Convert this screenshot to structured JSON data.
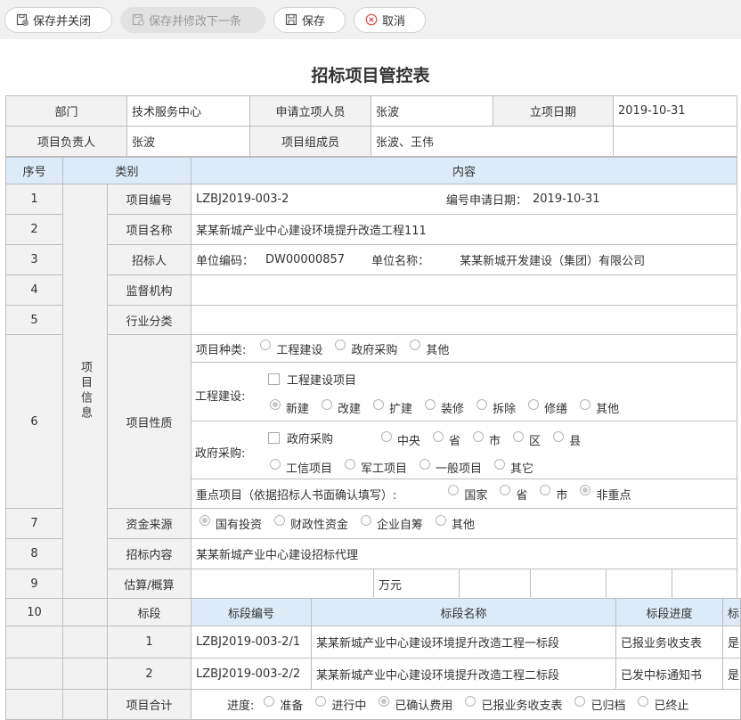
{
  "toolbar": {
    "save_close": "保存并关闭",
    "save_next": "保存并修改下一条",
    "save": "保存",
    "cancel": "取消"
  },
  "title": "招标项目管控表",
  "header": {
    "dept_label": "部门",
    "dept_value": "技术服务中心",
    "applicant_label": "申请立项人员",
    "applicant_value": "张波",
    "date_label": "立项日期",
    "date_value": "2019-10-31",
    "leader_label": "项目负责人",
    "leader_value": "张波",
    "members_label": "项目组成员",
    "members_value": "张波、王伟"
  },
  "cols": {
    "no": "序号",
    "category": "类别",
    "content": "内容"
  },
  "group_label": "项目信息",
  "rows": {
    "r1": {
      "no": "1",
      "label": "项目编号",
      "code": "LZBJ2019-003-2",
      "date_label": "编号申请日期：",
      "date_value": "2019-10-31"
    },
    "r2": {
      "no": "2",
      "label": "项目名称",
      "value": "某某新城产业中心建设环境提升改造工程111"
    },
    "r3": {
      "no": "3",
      "label": "招标人",
      "code_label": "单位编码：",
      "code_value": "DW00000857",
      "name_label": "单位名称：",
      "name_value": "某某新城开发建设（集团）有限公司"
    },
    "r4": {
      "no": "4",
      "label": "监督机构"
    },
    "r5": {
      "no": "5",
      "label": "行业分类"
    },
    "r6": {
      "no": "6",
      "label": "项目性质",
      "kind_label": "项目种类:",
      "kind_opts": [
        "工程建设",
        "政府采购",
        "其他"
      ],
      "eng_label": "工程建设:",
      "eng_check": "工程建设项目",
      "eng_opts": [
        "新建",
        "改建",
        "扩建",
        "装修",
        "拆除",
        "修缮",
        "其他"
      ],
      "gov_label": "政府采购:",
      "gov_check": "政府采购",
      "gov_level_opts": [
        "中央",
        "省",
        "市",
        "区",
        "县"
      ],
      "gov_type_opts": [
        "工信项目",
        "军工项目",
        "一般项目",
        "其它"
      ],
      "key_label": "重点项目（依据招标人书面确认填写）:",
      "key_opts": [
        "国家",
        "省",
        "市",
        "非重点"
      ]
    },
    "r7": {
      "no": "7",
      "label": "资金来源",
      "opts": [
        "国有投资",
        "财政性资金",
        "企业自筹",
        "其他"
      ]
    },
    "r8": {
      "no": "8",
      "label": "招标内容",
      "value": "某某新城产业中心建设招标代理"
    },
    "r9": {
      "no": "9",
      "label": "估算/概算",
      "unit": "万元"
    },
    "r10": {
      "no": "10",
      "label": "标段",
      "col_code": "标段编号",
      "col_name": "标段名称",
      "col_progress": "标段进度",
      "col_extra": "标"
    },
    "lots": [
      {
        "no": "1",
        "code": "LZBJ2019-003-2/1",
        "name": "某某新城产业中心建设环境提升改造工程一标段",
        "progress": "已报业务收支表",
        "extra": "是"
      },
      {
        "no": "2",
        "code": "LZBJ2019-003-2/2",
        "name": "某某新城产业中心建设环境提升改造工程二标段",
        "progress": "已发中标通知书",
        "extra": "是"
      }
    ],
    "total": {
      "label": "项目合计",
      "progress_label": "进度:",
      "opts": [
        "准备",
        "进行中",
        "已确认费用",
        "已报业务收支表",
        "已归档",
        "已终止"
      ]
    }
  }
}
